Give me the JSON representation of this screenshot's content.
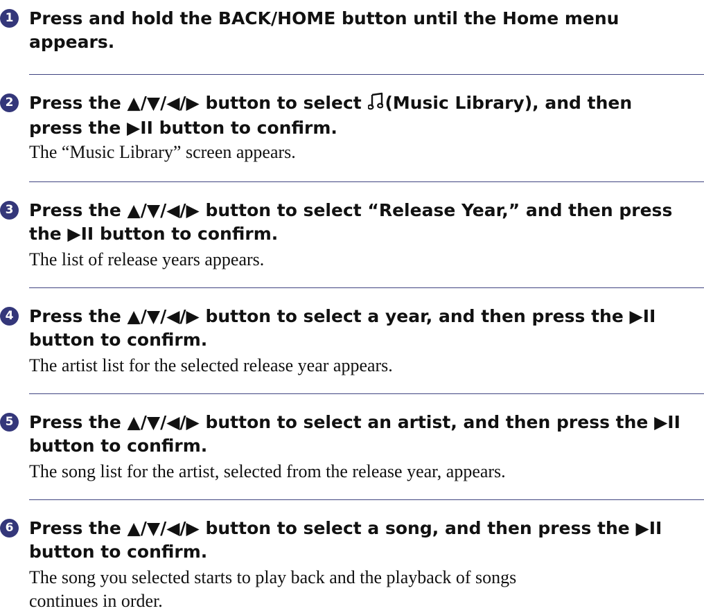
{
  "steps": [
    {
      "number": "1",
      "instruction_lines": [
        "Press and hold the BACK/HOME button until the Home menu",
        "appears."
      ],
      "result_lines": []
    },
    {
      "number": "2",
      "instruction_prefix": "Press the ▲/▼/◀/▶ button to select",
      "icon": "music-note-icon",
      "instruction_suffix": "(Music Library), and then",
      "instruction_line2": "press the ▶II button to confirm.",
      "result_lines": [
        "The “Music Library” screen appears."
      ]
    },
    {
      "number": "3",
      "instruction_lines": [
        "Press the ▲/▼/◀/▶ button to select “Release Year,” and then press",
        "the ▶II button to confirm."
      ],
      "result_lines": [
        "The list of release years appears."
      ]
    },
    {
      "number": "4",
      "instruction_lines": [
        "Press the ▲/▼/◀/▶ button to select a year, and then press the ▶II",
        "button to confirm."
      ],
      "result_lines": [
        "The artist list for the selected release year appears."
      ]
    },
    {
      "number": "5",
      "instruction_lines": [
        "Press the ▲/▼/◀/▶ button to select an artist, and then press the ▶II",
        "button to confirm."
      ],
      "result_lines": [
        "The song list for the artist, selected from the release year, appears."
      ]
    },
    {
      "number": "6",
      "instruction_lines": [
        "Press the ▲/▼/◀/▶ button to select a song, and then press the ▶II",
        "button to confirm."
      ],
      "result_lines": [
        "The song you selected starts to play back and the playback of songs",
        "continues in order."
      ]
    }
  ],
  "colors": {
    "badge": "#34377a",
    "rule": "#3f4380",
    "text": "#111111"
  }
}
